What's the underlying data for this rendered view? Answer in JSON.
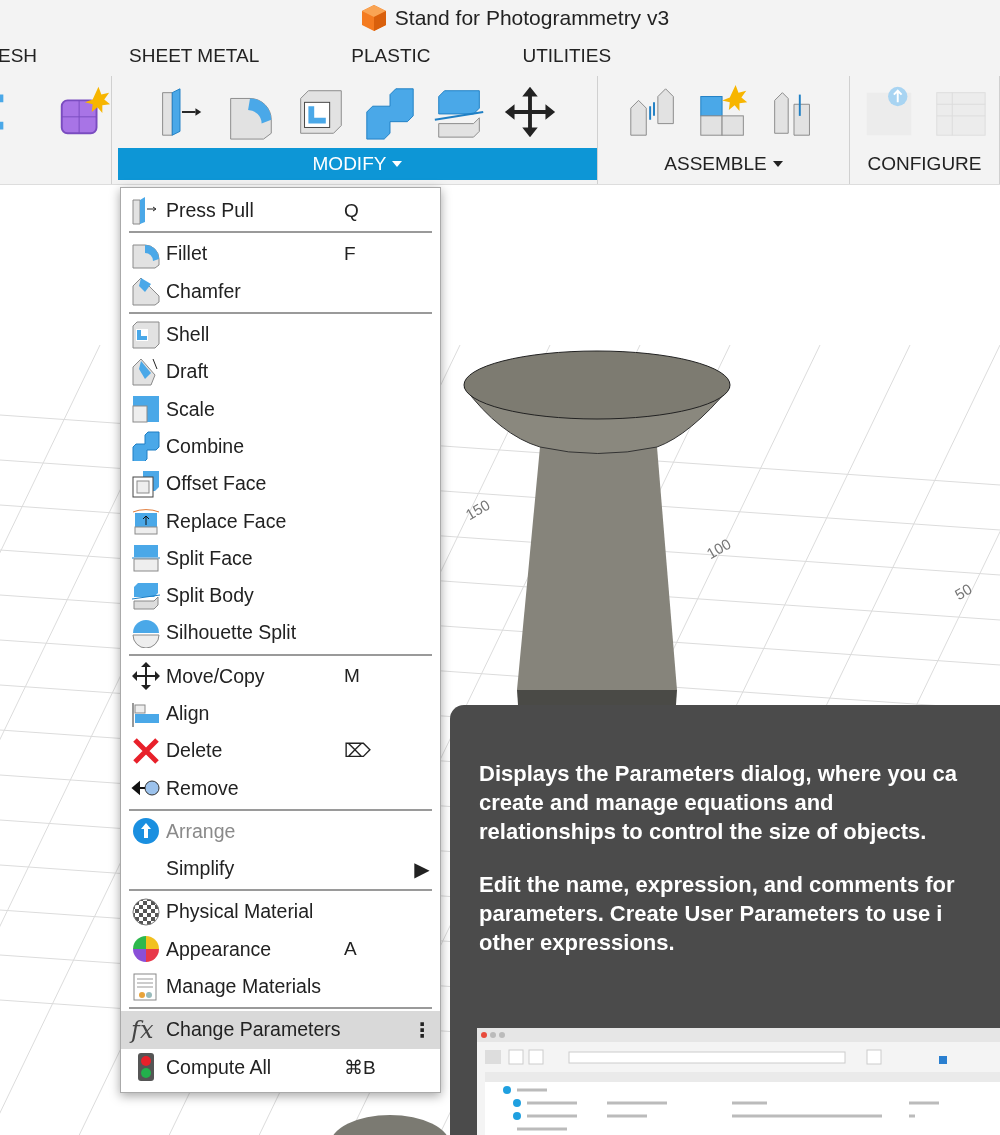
{
  "window": {
    "title": "Stand for Photogrammetry v3"
  },
  "tabs": [
    {
      "label": "ESH"
    },
    {
      "label": "SHEET METAL"
    },
    {
      "label": "PLASTIC"
    },
    {
      "label": "UTILITIES"
    }
  ],
  "toolbar_groups": [
    {
      "label": "MODIFY",
      "selected": true,
      "dropdown": true
    },
    {
      "label": "ASSEMBLE",
      "selected": false,
      "dropdown": true
    },
    {
      "label": "CONFIGURE",
      "selected": false,
      "dropdown": false
    }
  ],
  "viewport": {
    "axis_labels": [
      "150",
      "100",
      "50"
    ]
  },
  "menu": {
    "sections": [
      {
        "items": [
          {
            "label": "Press Pull",
            "shortcut": "Q",
            "selected": false,
            "disabled": false
          }
        ]
      },
      {
        "items": [
          {
            "label": "Fillet",
            "shortcut": "F",
            "selected": false,
            "disabled": false
          },
          {
            "label": "Chamfer",
            "selected": false,
            "disabled": false
          }
        ]
      },
      {
        "items": [
          {
            "label": "Shell",
            "selected": false,
            "disabled": false
          },
          {
            "label": "Draft",
            "selected": false,
            "disabled": false
          },
          {
            "label": "Scale",
            "selected": false,
            "disabled": false
          },
          {
            "label": "Combine",
            "selected": false,
            "disabled": false
          },
          {
            "label": "Offset Face",
            "selected": false,
            "disabled": false
          },
          {
            "label": "Replace Face",
            "selected": false,
            "disabled": false
          },
          {
            "label": "Split Face",
            "selected": false,
            "disabled": false
          },
          {
            "label": "Split Body",
            "selected": false,
            "disabled": false
          },
          {
            "label": "Silhouette Split",
            "selected": false,
            "disabled": false
          }
        ]
      },
      {
        "items": [
          {
            "label": "Move/Copy",
            "shortcut": "M",
            "selected": false,
            "disabled": false
          },
          {
            "label": "Align",
            "selected": false,
            "disabled": false
          },
          {
            "label": "Delete",
            "shortcut": "⌦",
            "selected": false,
            "disabled": false
          },
          {
            "label": "Remove",
            "selected": false,
            "disabled": false
          }
        ]
      },
      {
        "items": [
          {
            "label": "Arrange",
            "selected": false,
            "disabled": true
          },
          {
            "label": "Simplify",
            "trailing": "▶",
            "selected": false,
            "disabled": false
          }
        ]
      },
      {
        "items": [
          {
            "label": "Physical Material",
            "selected": false,
            "disabled": false
          },
          {
            "label": "Appearance",
            "shortcut": "A",
            "selected": false,
            "disabled": false
          },
          {
            "label": "Manage Materials",
            "selected": false,
            "disabled": false
          }
        ]
      },
      {
        "items": [
          {
            "label": "Change Parameters",
            "icon_text": "fx",
            "trailing": "⋮",
            "selected": true,
            "disabled": false
          },
          {
            "label": "Compute All",
            "shortcut": "⌘B",
            "selected": false,
            "disabled": false
          }
        ]
      }
    ]
  },
  "tooltip": {
    "paragraphs": [
      [
        "Displays the Parameters dialog, where you ca",
        "create and manage equations and",
        "relationships to control the size of objects."
      ],
      [
        "Edit the name, expression, and comments for",
        "parameters. Create User Parameters to use i",
        "other expressions."
      ]
    ]
  }
}
